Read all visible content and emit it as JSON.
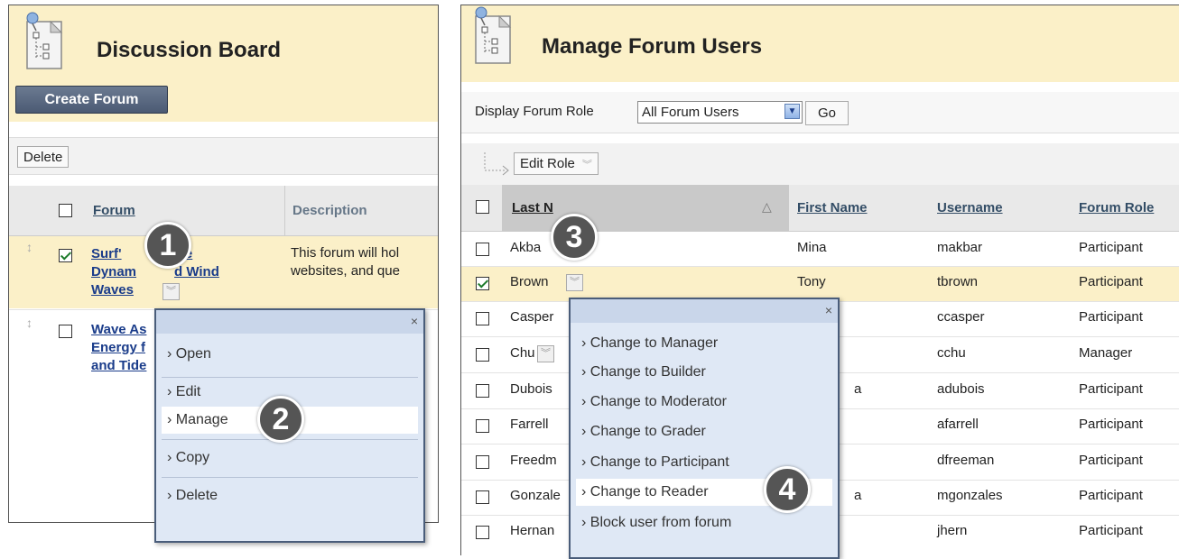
{
  "left": {
    "title": "Discussion Board",
    "create_forum": "Create Forum",
    "delete": "Delete",
    "columns": {
      "forum": "Forum",
      "description": "Description"
    },
    "rows": [
      {
        "forum_line1": "Surf'",
        "forum_line1b": "ve",
        "forum_line2": "Dynam",
        "forum_line2b": "d Wind",
        "forum_line3": "Waves",
        "description_line1": "This forum will hol",
        "description_line2": "websites, and que",
        "checked": true
      },
      {
        "forum_line1": "Wave As",
        "forum_line2": "Energy f",
        "forum_line3": "and Tide",
        "checked": false
      }
    ],
    "menu": {
      "items": [
        "Open",
        "Edit",
        "Manage",
        "Copy",
        "Delete"
      ],
      "active": "Manage",
      "close": "×"
    },
    "badges": [
      "1",
      "2"
    ]
  },
  "right": {
    "title": "Manage Forum Users",
    "filter_label": "Display Forum Role",
    "filter_value": "All Forum Users",
    "go": "Go",
    "edit_role": "Edit Role",
    "columns": {
      "last_name": "Last N",
      "first_name": "First Name",
      "username": "Username",
      "forum_role": "Forum Role"
    },
    "rows": [
      {
        "last": "Akba",
        "first": "Mina",
        "username": "makbar",
        "role": "Participant",
        "checked": false
      },
      {
        "last": "Brown",
        "first": "Tony",
        "username": "tbrown",
        "role": "Participant",
        "checked": true
      },
      {
        "last": "Casper",
        "first": "",
        "username": "ccasper",
        "role": "Participant",
        "checked": false
      },
      {
        "last": "Chu",
        "first": "",
        "username": "cchu",
        "role": "Manager",
        "checked": false
      },
      {
        "last": "Dubois",
        "first": "a",
        "username": "adubois",
        "role": "Participant",
        "checked": false
      },
      {
        "last": "Farrell",
        "first": "",
        "username": "afarrell",
        "role": "Participant",
        "checked": false
      },
      {
        "last": "Freedm",
        "first": "",
        "username": "dfreeman",
        "role": "Participant",
        "checked": false
      },
      {
        "last": "Gonzale",
        "first": "a",
        "username": "mgonzales",
        "role": "Participant",
        "checked": false
      },
      {
        "last": "Hernan",
        "first": "",
        "username": "jhern",
        "role": "Participant",
        "checked": false
      }
    ],
    "menu": {
      "items": [
        "Change to Manager",
        "Change to Builder",
        "Change to Moderator",
        "Change to Grader",
        "Change to Participant",
        "Change to Reader",
        "Block user from forum"
      ],
      "active": "Change to Reader",
      "close": "×"
    },
    "badges": [
      "3",
      "4"
    ]
  },
  "colors": {
    "header_bg": "#fbf0c8",
    "menu_bg": "#dfe8f5",
    "menu_border": "#4a5d7a",
    "badge": "#555555",
    "link": "#1a3c8a"
  }
}
